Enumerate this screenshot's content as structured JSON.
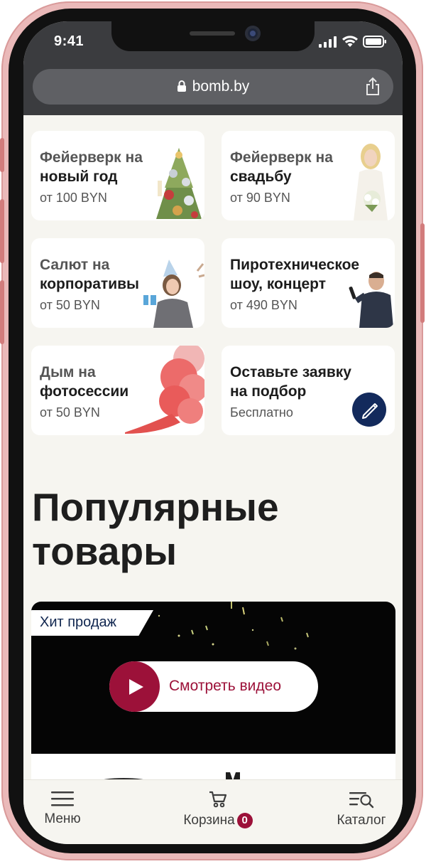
{
  "status_bar": {
    "time": "9:41"
  },
  "browser": {
    "url": "bomb.by"
  },
  "cards": [
    {
      "title_line1": "Фейерверк на",
      "title_line2": "новый год",
      "price": "от 100 BYN"
    },
    {
      "title_line1": "Фейерверк на",
      "title_line2": "свадьбу",
      "price": "от 90 BYN"
    },
    {
      "title_line1": "Салют на",
      "title_line2": "корпоративы",
      "price": "от 50 BYN"
    },
    {
      "title_line1": "Пиротехническое",
      "title_line2": "шоу, концерт",
      "price": "от 490 BYN"
    },
    {
      "title_line1": "Дым на",
      "title_line2": "фотосессии",
      "price": "от 50 BYN"
    },
    {
      "title_line1": "Оставьте заявку",
      "title_line2": "на подбор",
      "price": "Бесплатно"
    }
  ],
  "popular": {
    "title_line1": "Популярные",
    "title_line2": "товары",
    "hit_label": "Хит продаж",
    "watch_video": "Смотреть видео"
  },
  "bottom_nav": {
    "menu": "Меню",
    "cart": "Корзина",
    "cart_count": "0",
    "catalog": "Каталог"
  },
  "colors": {
    "accent": "#9c1139",
    "navy": "#132a5c",
    "background": "#f6f5f0"
  }
}
